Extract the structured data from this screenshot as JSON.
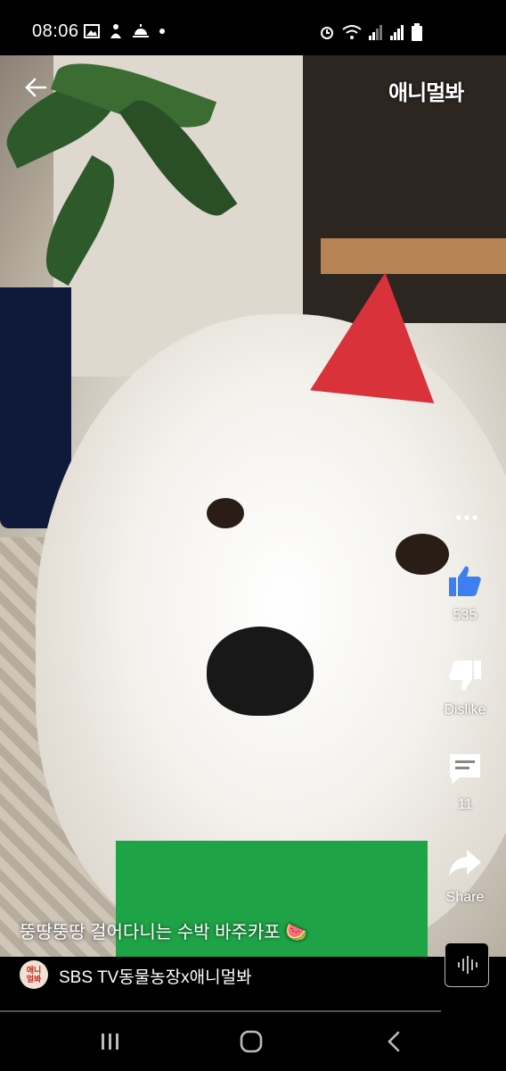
{
  "status_bar": {
    "time": "08:06",
    "left_icons": [
      "image-icon",
      "person-icon",
      "sunrise-icon",
      "dot-icon"
    ],
    "right_icons": [
      "alarm-icon",
      "wifi-icon",
      "signal-icon",
      "signal-icon",
      "battery-icon"
    ]
  },
  "header": {
    "back_icon": "arrow-left-icon",
    "channel_logo_text": "애니멀봐"
  },
  "actions": {
    "more_icon": "more-horizontal-icon",
    "like": {
      "icon": "thumbs-up-icon",
      "label": "535",
      "active_color": "#3d7ff0"
    },
    "dislike": {
      "icon": "thumbs-down-icon",
      "label": "Dislike"
    },
    "comments": {
      "icon": "comment-icon",
      "label": "11"
    },
    "share": {
      "icon": "share-arrow-icon",
      "label": "Share"
    }
  },
  "video": {
    "caption": "뚱땅뚱땅 걸어다니는 수박 바주카포 🍉"
  },
  "channel": {
    "avatar_text": "애니\n멀봐",
    "name": "SBS TV동물농장x애니멀봐"
  },
  "controls": {
    "audio_icon": "audio-waveform-icon"
  },
  "nav": {
    "recents_icon": "recents-icon",
    "home_icon": "home-icon",
    "back_icon": "chevron-left-icon"
  }
}
